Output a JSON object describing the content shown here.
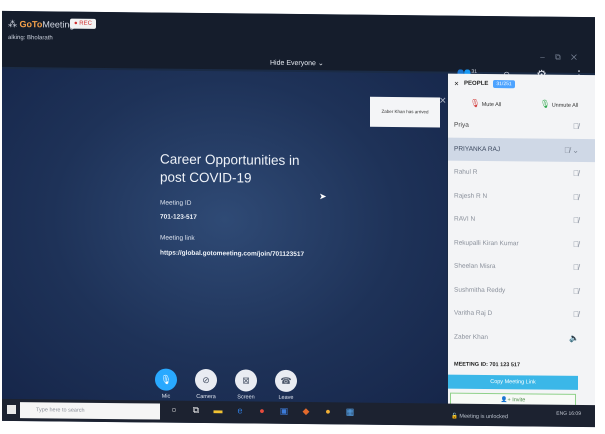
{
  "window": {
    "app_name_bold": "GoTo",
    "app_name_rest": "Meeting",
    "app_arrow": "▾",
    "rec_label": "● REC",
    "talking": "alking: Bholarath",
    "hide_everyone": "Hide Everyone  ⌄",
    "win_controls": "– ⧉ ✕"
  },
  "top_icons": {
    "people_count": "31",
    "icons": [
      "people-icon",
      "chat-icon",
      "settings-icon",
      "more-icon"
    ]
  },
  "toast": {
    "text": "Zaber Khan has arrived",
    "close": "✕"
  },
  "meeting": {
    "title_line1": "Career Opportunities in",
    "title_line2": "post COVID-19",
    "id_label": "Meeting ID",
    "id_value": "701-123-517",
    "link_label": "Meeting link",
    "link_value": "https://global.gotomeeting.com/join/701123517"
  },
  "controls": [
    {
      "label": "Mic",
      "glyph": "🎙"
    },
    {
      "label": "Camera",
      "glyph": "⊘"
    },
    {
      "label": "Screen",
      "glyph": "⊠"
    },
    {
      "label": "Leave",
      "glyph": "☎"
    }
  ],
  "panel": {
    "close": "✕",
    "title": "PEOPLE",
    "count": "31/251",
    "mute_all": "Mute All",
    "unmute_all": "Unmute All",
    "participants": [
      {
        "name": "Priya",
        "selected": false
      },
      {
        "name": "PRIYANKA RAJ",
        "selected": true
      },
      {
        "name": "Rahul R",
        "selected": false
      },
      {
        "name": "Rajesh R N",
        "selected": false
      },
      {
        "name": "RAVI N",
        "selected": false
      },
      {
        "name": "Rekupalli Kiran Kumar",
        "selected": false
      },
      {
        "name": "Sheelan Misra",
        "selected": false
      },
      {
        "name": "Sushmitha Reddy",
        "selected": false
      },
      {
        "name": "Varitha Raj D",
        "selected": false
      },
      {
        "name": "Zaber Khan",
        "selected": false
      }
    ],
    "meeting_id": "MEETING ID:  701 123 517",
    "copy_link": "Copy Meeting Link",
    "invite": "Invite",
    "unlocked": "Meeting is unlocked"
  },
  "taskbar": {
    "search_placeholder": "Type here to search",
    "tray_text": "ENG  16:09"
  }
}
